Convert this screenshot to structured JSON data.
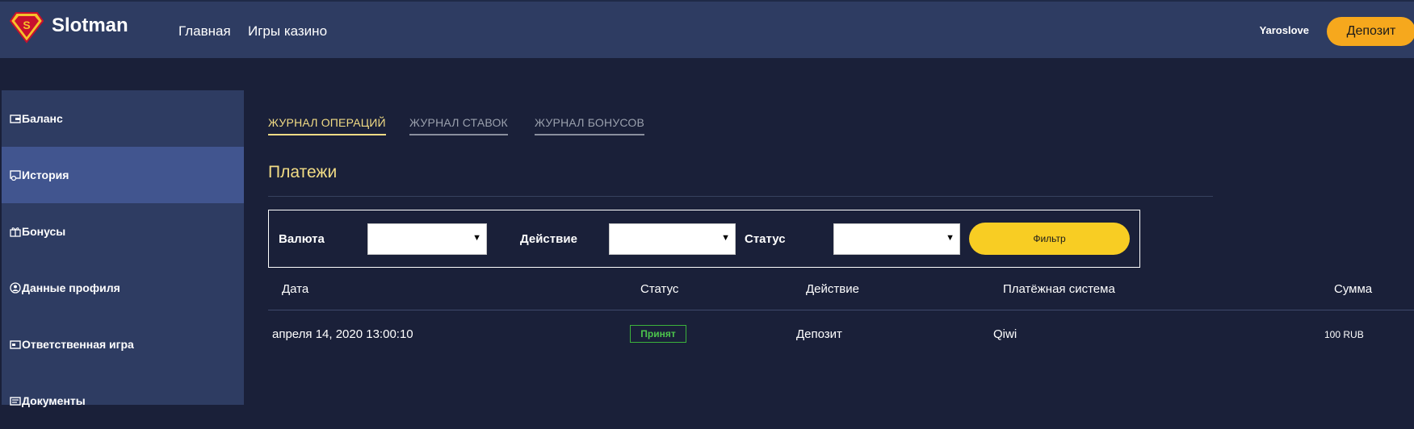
{
  "header": {
    "brand": "Slotman",
    "nav": [
      "Главная",
      "Игры казино"
    ],
    "username": "Yaroslove",
    "deposit_label": "Депозит"
  },
  "sidebar": {
    "items": [
      {
        "label": "Баланс",
        "icon": "wallet-icon"
      },
      {
        "label": "История",
        "icon": "history-icon",
        "active": true
      },
      {
        "label": "Бонусы",
        "icon": "gift-icon"
      },
      {
        "label": "Данные профиля",
        "icon": "user-icon"
      },
      {
        "label": "Ответственная игра",
        "icon": "card-icon"
      },
      {
        "label": "Документы",
        "icon": "document-icon"
      }
    ]
  },
  "tabs": [
    {
      "label": "ЖУРНАЛ ОПЕРАЦИЙ",
      "active": true
    },
    {
      "label": "ЖУРНАЛ СТАВОК",
      "active": false
    },
    {
      "label": "ЖУРНАЛ БОНУСОВ",
      "active": false
    }
  ],
  "section_title": "Платежи",
  "filters": {
    "currency_label": "Валюта",
    "action_label": "Действие",
    "status_label": "Статус",
    "filter_button": "Фильтр"
  },
  "table": {
    "headers": [
      "Дата",
      "Статус",
      "Действие",
      "Платёжная система",
      "Сумма"
    ],
    "rows": [
      {
        "date": "апреля 14, 2020 13:00:10",
        "status": "Принят",
        "action": "Депозит",
        "system": "Qiwi",
        "amount": "100 RUB"
      }
    ]
  },
  "colors": {
    "background": "#1a2039",
    "header": "#2e3c62",
    "sidebar_active": "#41558f",
    "accent_gold": "#f2dc85",
    "deposit_button": "#f6a81d",
    "filter_button": "#f8cd23",
    "status_accepted": "#3cb23c"
  }
}
